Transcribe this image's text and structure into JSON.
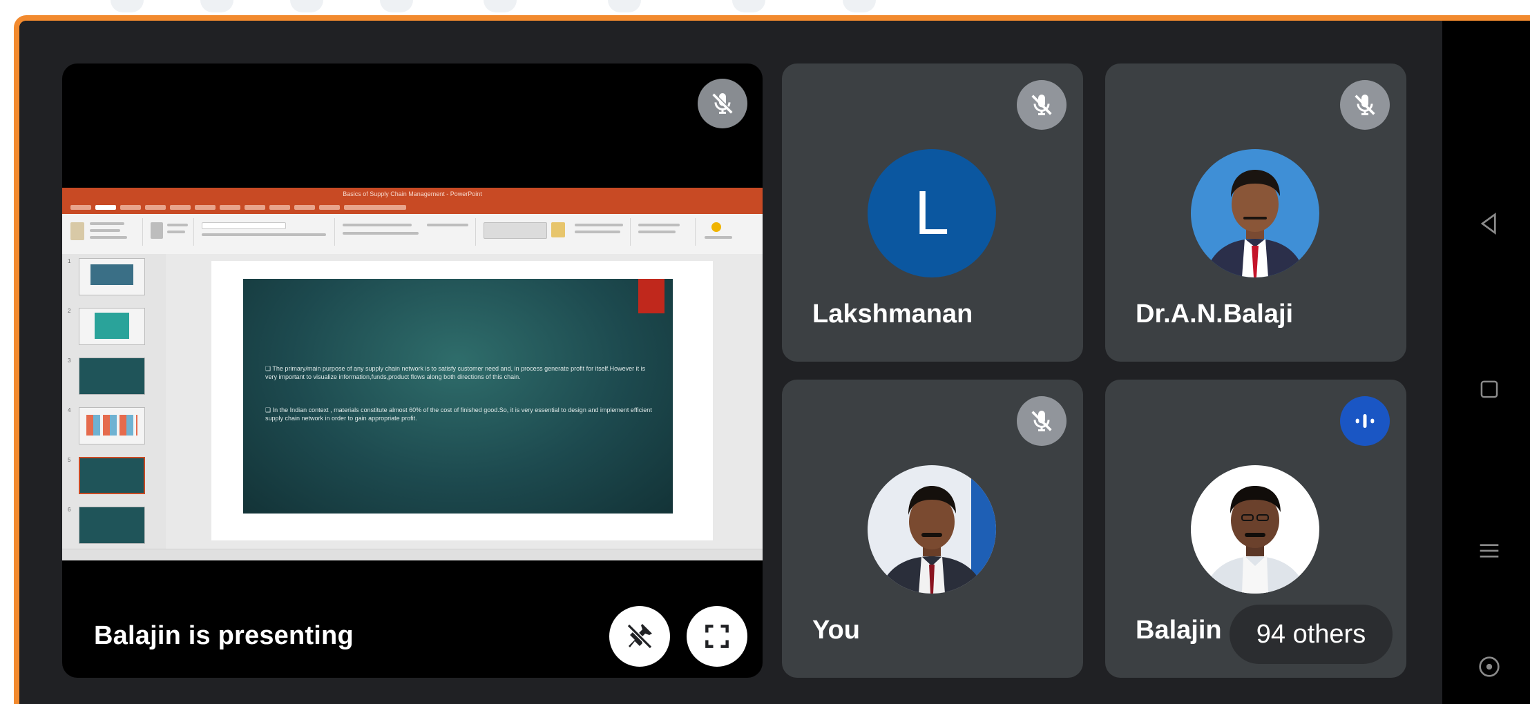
{
  "presentation": {
    "status_label": "Balajin is presenting",
    "slide": {
      "app_title": "Basics of Supply Chain Management - PowerPoint",
      "bullets": [
        "❑ The primary/main purpose of any supply chain network is to satisfy customer need and, in process generate profit for itself.However it is very important to visualize information,funds,product flows along both directions of this chain.",
        "❑ In the Indian context , materials constitute almost 60% of the cost of finished good.So, it is very essential to design and implement efficient supply chain network in order to gain appropriate profit."
      ]
    }
  },
  "participants": [
    {
      "name": "Lakshmanan",
      "avatar_letter": "L",
      "muted": true
    },
    {
      "name": "Dr.A.N.Balaji",
      "muted": true
    },
    {
      "name": "You",
      "muted": true
    },
    {
      "name": "Balajin",
      "speaking": true
    }
  ],
  "others_count_label": "94 others",
  "colors": {
    "accent_border": "#f28a2e",
    "background": "#202124",
    "tile": "#3c4043",
    "avatar_blue": "#0b57a0",
    "speaking_blue": "#1a56c4"
  },
  "icons": {
    "mic_off": "mic-off-icon",
    "unpin": "unpin-icon",
    "fullscreen": "fullscreen-icon",
    "speaking": "audio-level-icon",
    "nav_back": "back-triangle-icon",
    "nav_home": "home-square-icon",
    "nav_menu": "menu-lines-icon",
    "nav_assist": "assist-circle-icon"
  }
}
